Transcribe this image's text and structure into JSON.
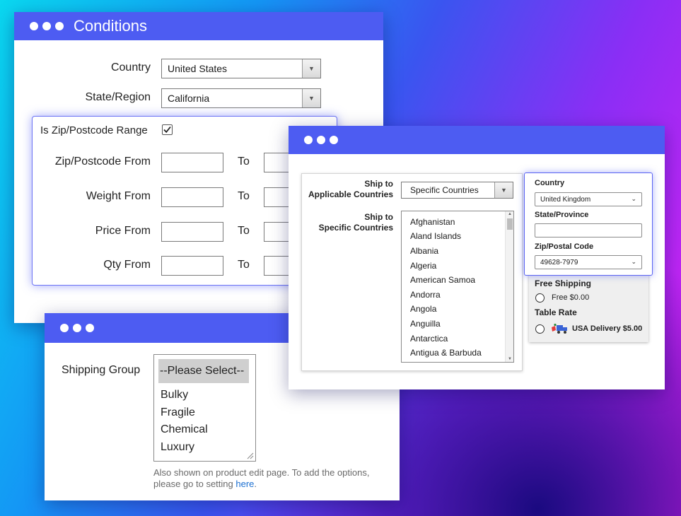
{
  "conditions": {
    "title": "Conditions",
    "country_label": "Country",
    "country_value": "United States",
    "state_label": "State/Region",
    "state_value": "California",
    "zip_range_label": "Is Zip/Postcode Range",
    "zip_range_checked": true,
    "zip_from_label": "Zip/Postcode From",
    "weight_from_label": "Weight From",
    "price_from_label": "Price From",
    "qty_from_label": "Qty From",
    "to_label": "To"
  },
  "shipping_group": {
    "label": "Shipping Group",
    "options": [
      "--Please Select--",
      "Bulky",
      "Fragile",
      "Chemical",
      "Luxury"
    ],
    "help_text": "Also shown on product edit page. To add the options, please go to setting ",
    "help_link": "here",
    "help_end": "."
  },
  "ship_to": {
    "applicable_label_1": "Ship to",
    "applicable_label_2": "Applicable Countries",
    "applicable_value": "Specific Countries",
    "specific_label_1": "Ship to",
    "specific_label_2": "Specific Countries",
    "countries": [
      "Afghanistan",
      "Aland Islands",
      "Albania",
      "Algeria",
      "American Samoa",
      "Andorra",
      "Angola",
      "Anguilla",
      "Antarctica",
      "Antigua & Barbuda"
    ]
  },
  "estimate": {
    "country_label": "Country",
    "country_value": "United Kingdom",
    "state_label": "State/Province",
    "state_value": "",
    "zip_label": "Zip/Postal Code",
    "zip_value": "49628-7979",
    "free_shipping_label": "Free Shipping",
    "free_option": "Free $0.00",
    "table_rate_label": "Table Rate",
    "usa_option": "USA Delivery $5.00"
  },
  "colors": {
    "accent": "#4d5cf2",
    "link": "#1a6fd1"
  },
  "icons": {
    "checkbox": "check-icon",
    "dropdown": "chevron-down-icon",
    "delivery": "delivery-truck-icon"
  }
}
